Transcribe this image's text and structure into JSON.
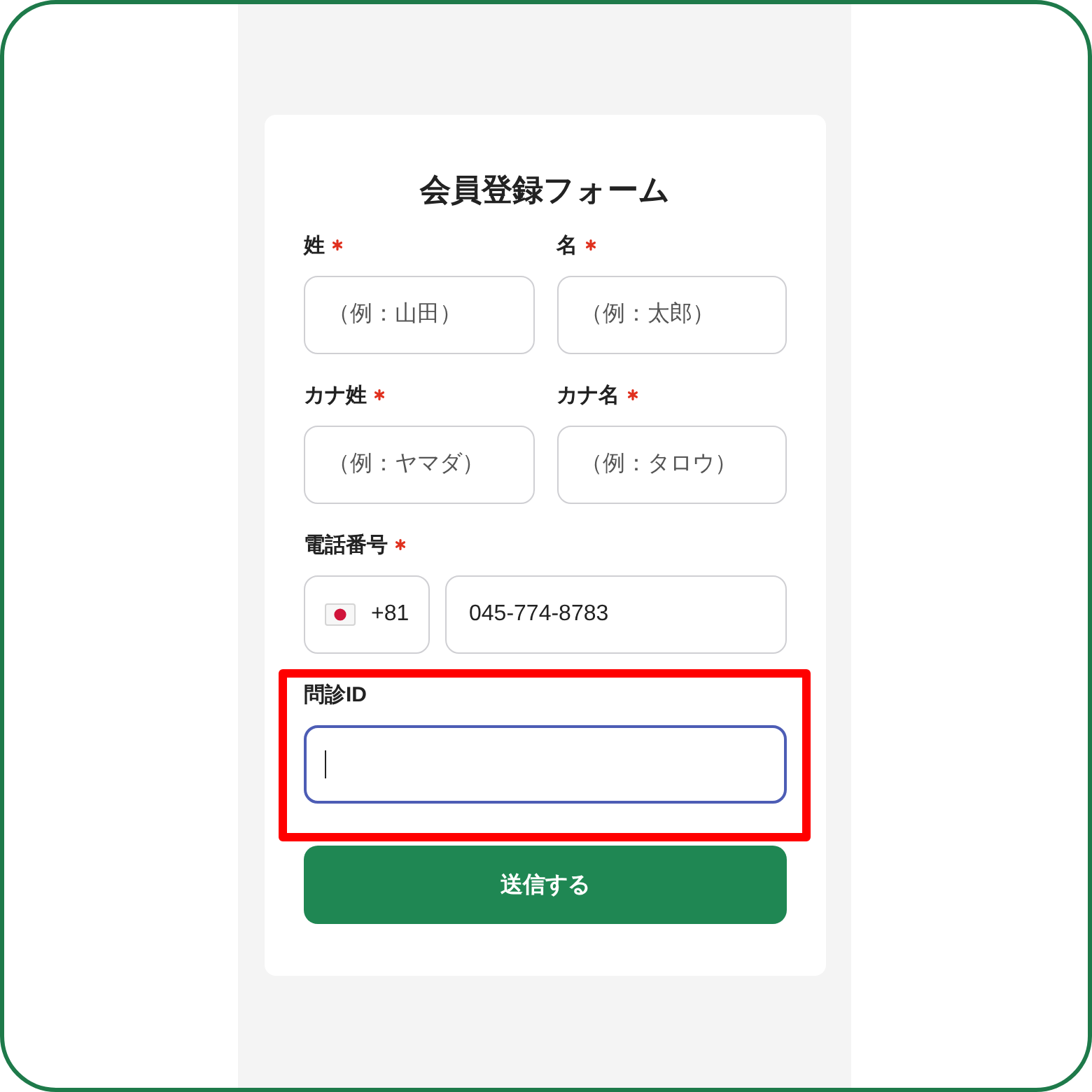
{
  "form": {
    "title": "会員登録フォーム",
    "rows": [
      {
        "fields": [
          {
            "kind": "text",
            "label": "姓",
            "required": true,
            "placeholder": "（例：山田）",
            "focused": false,
            "highlighted": false
          },
          {
            "kind": "text",
            "label": "名",
            "required": true,
            "placeholder": "（例：太郎）",
            "focused": false,
            "highlighted": false
          }
        ]
      },
      {
        "fields": [
          {
            "kind": "text",
            "label": "カナ姓",
            "required": true,
            "placeholder": "（例：ヤマダ）",
            "focused": false,
            "highlighted": false
          },
          {
            "kind": "text",
            "label": "カナ名",
            "required": true,
            "placeholder": "（例：タロウ）",
            "focused": false,
            "highlighted": false
          }
        ]
      },
      {
        "fields": [
          {
            "kind": "phone",
            "label": "電話番号",
            "required": true,
            "country_code": "+81",
            "value": "045-774-8783",
            "focused": false,
            "highlighted": false
          }
        ]
      },
      {
        "fields": [
          {
            "kind": "text",
            "label": "問診ID",
            "required": false,
            "focused": true,
            "highlighted": true
          }
        ]
      }
    ],
    "submit_button": {
      "label": "送信する"
    }
  }
}
